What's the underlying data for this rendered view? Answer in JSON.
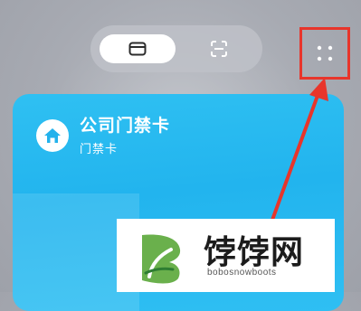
{
  "toolbar": {
    "modes": [
      {
        "icon": "card-mode-icon",
        "selected": true
      },
      {
        "icon": "scan-mode-icon",
        "selected": false
      }
    ],
    "more_icon": "more-dots-icon"
  },
  "card": {
    "title": "公司门禁卡",
    "subtitle": "门禁卡",
    "icon": "home-icon",
    "color": "#22b4ee"
  },
  "annotation": {
    "color": "#e8352b"
  },
  "watermark": {
    "name": "饽饽网",
    "domain": "bobosnowboots"
  }
}
